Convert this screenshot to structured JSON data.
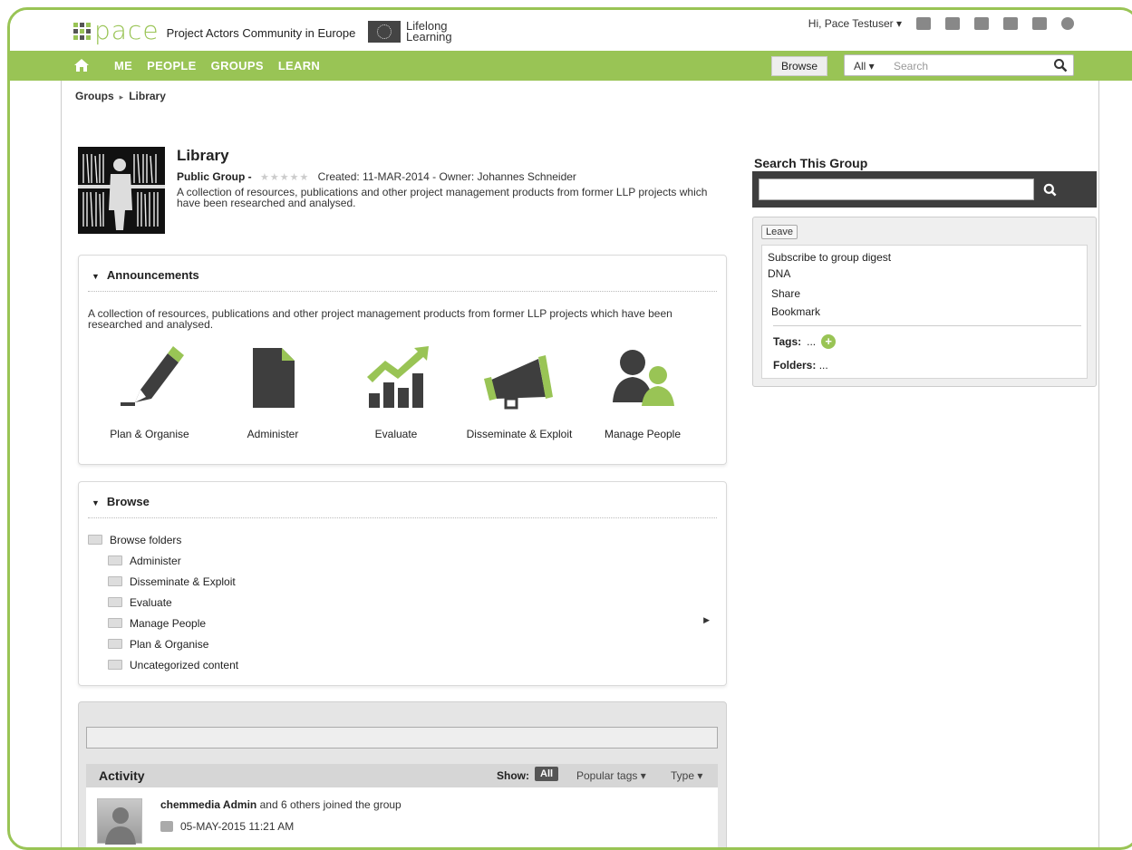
{
  "header": {
    "logo_word": "pace",
    "logo_subtitle": "Project Actors Community in Europe",
    "partner_text_line1": "Lifelong",
    "partner_text_line2": "Learning",
    "greeting": "Hi, Pace Testuser",
    "icons": [
      "mail-icon",
      "contacts-icon",
      "calendar-icon",
      "bookmark-icon",
      "gift-icon",
      "help-icon"
    ]
  },
  "nav": {
    "items": [
      "ME",
      "PEOPLE",
      "GROUPS",
      "LEARN"
    ],
    "browse_label": "Browse",
    "search_scope": "All",
    "search_placeholder": "Search"
  },
  "breadcrumb": [
    "Groups",
    "Library"
  ],
  "group": {
    "title": "Library",
    "type": "Public Group -",
    "created": "Created: 11-MAR-2014 - Owner: Johannes Schneider",
    "description": "A collection of resources, publications and other project management products from former LLP projects which have been researched and analysed.",
    "rating_stars": "★★★★★"
  },
  "announcements": {
    "heading": "Announcements",
    "text": "A collection of resources, publications and other project management products from former LLP projects which have been researched and analysed.",
    "tiles": [
      {
        "label": "Plan & Organise",
        "icon": "pen-icon"
      },
      {
        "label": "Administer",
        "icon": "document-icon"
      },
      {
        "label": "Evaluate",
        "icon": "chart-icon"
      },
      {
        "label": "Disseminate & Exploit",
        "icon": "megaphone-icon"
      },
      {
        "label": "Manage People",
        "icon": "people-icon"
      }
    ]
  },
  "browse": {
    "heading": "Browse",
    "root": "Browse folders",
    "folders": [
      "Administer",
      "Disseminate & Exploit",
      "Evaluate",
      "Manage People",
      "Plan & Organise",
      "Uncategorized content"
    ]
  },
  "activity": {
    "title": "Activity",
    "show_label": "Show:",
    "show_all": "All",
    "popular_tags": "Popular tags",
    "type": "Type",
    "item_actor": "chemmedia Admin",
    "item_rest": "and 6 others joined the group",
    "item_time": "05-MAY-2015 11:21 AM"
  },
  "sidebar": {
    "search_title": "Search This Group",
    "leave": "Leave",
    "subscribe": "Subscribe to group digest",
    "dna": "DNA",
    "share": "Share",
    "bookmark": "Bookmark",
    "tags_label": "Tags:",
    "tags_value": "...",
    "folders_label": "Folders:",
    "folders_value": "..."
  },
  "colors": {
    "accent": "#99c455",
    "dark": "#3e3e3e"
  }
}
